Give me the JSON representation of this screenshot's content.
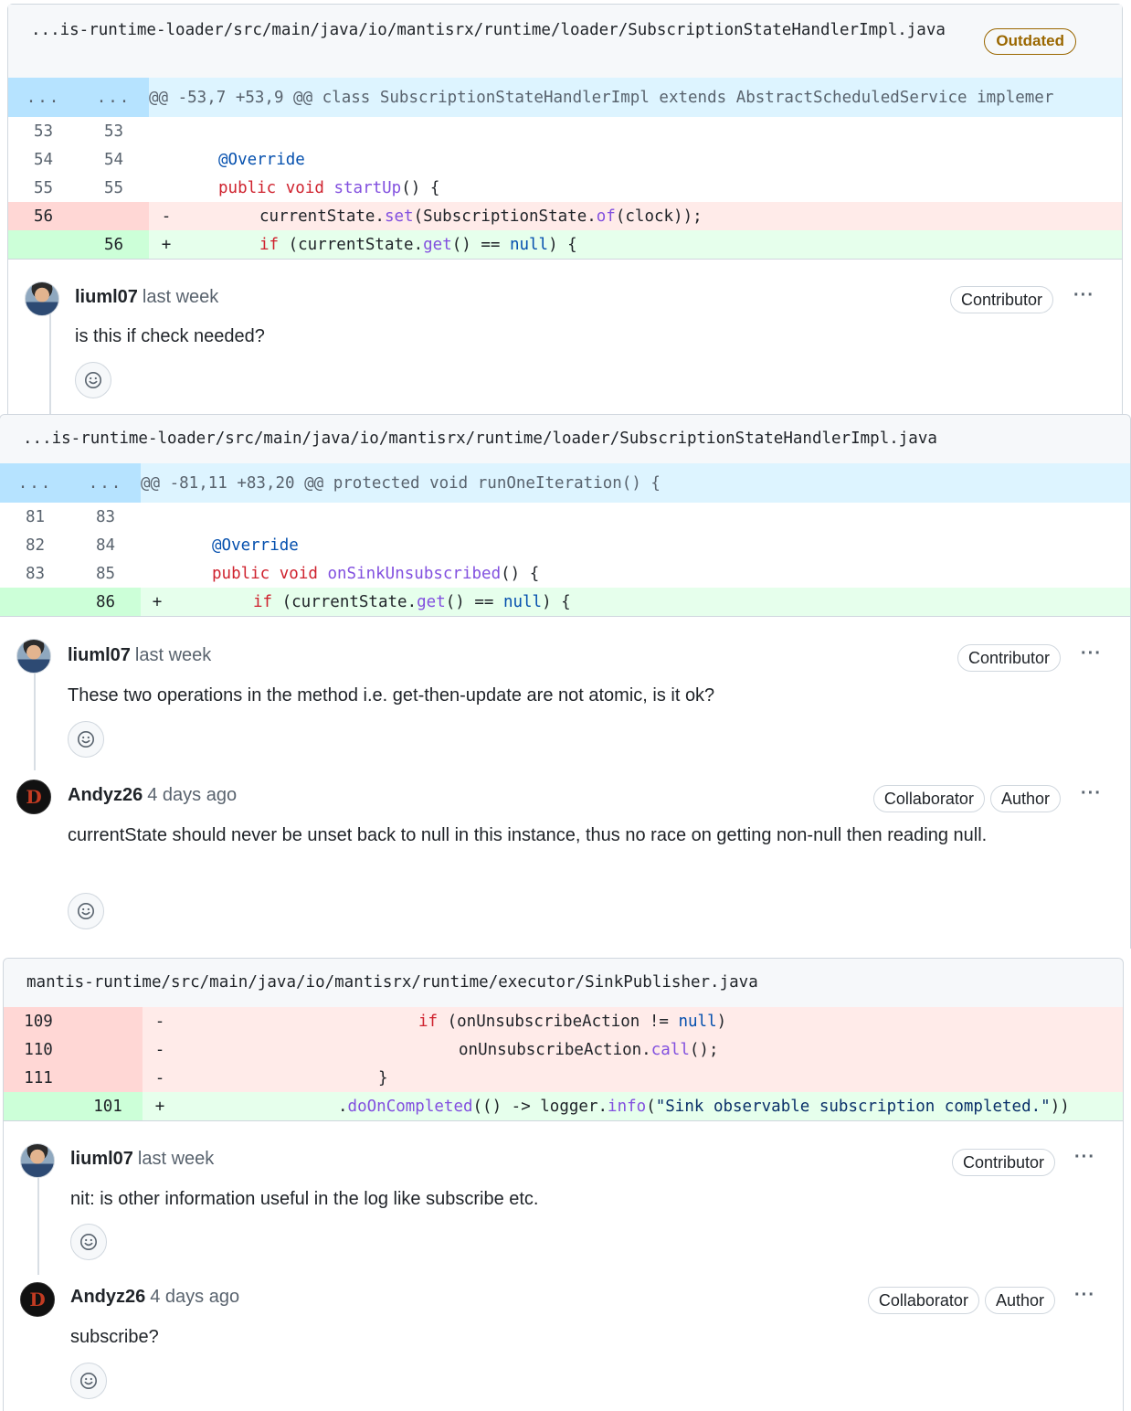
{
  "reviews": [
    {
      "file_path": "...is-runtime-loader/src/main/java/io/mantisrx/runtime/loader/SubscriptionStateHandlerImpl.java",
      "status_badge": "Outdated",
      "hunk_left": "...",
      "hunk_right": "...",
      "hunk_header": "@@ -53,7 +53,9 @@ class SubscriptionStateHandlerImpl extends AbstractScheduledService implemer",
      "lines": [
        {
          "old": "53",
          "new": "53",
          "sign": "",
          "code": ""
        },
        {
          "old": "54",
          "new": "54",
          "sign": "",
          "code": "@Override"
        },
        {
          "old": "55",
          "new": "55",
          "sign": "",
          "code": "public void startUp() {"
        },
        {
          "old": "56",
          "new": "",
          "sign": "-",
          "code": "currentState.set(SubscriptionState.of(clock));"
        },
        {
          "old": "",
          "new": "56",
          "sign": "+",
          "code": "if (currentState.get() == null) {"
        }
      ],
      "comments": [
        {
          "author": "liuml07",
          "time": "last week",
          "badges": [
            "Contributor"
          ],
          "text": "is this if check needed?"
        }
      ]
    },
    {
      "file_path": "...is-runtime-loader/src/main/java/io/mantisrx/runtime/loader/SubscriptionStateHandlerImpl.java",
      "hunk_left": "...",
      "hunk_right": "...",
      "hunk_header": "@@ -81,11 +83,20 @@ protected void runOneIteration() {",
      "lines": [
        {
          "old": "81",
          "new": "83",
          "sign": "",
          "code": ""
        },
        {
          "old": "82",
          "new": "84",
          "sign": "",
          "code": "@Override"
        },
        {
          "old": "83",
          "new": "85",
          "sign": "",
          "code": "public void onSinkUnsubscribed() {"
        },
        {
          "old": "",
          "new": "86",
          "sign": "+",
          "code": "if (currentState.get() == null) {"
        }
      ],
      "comments": [
        {
          "author": "liuml07",
          "time": "last week",
          "badges": [
            "Contributor"
          ],
          "text": "These two operations in the method i.e. get-then-update are not atomic, is it ok?"
        },
        {
          "author": "Andyz26",
          "time": "4 days ago",
          "badges": [
            "Collaborator",
            "Author"
          ],
          "text": "currentState should never be unset back to null in this instance, thus no race on getting non-null then reading null."
        }
      ]
    },
    {
      "file_path": "mantis-runtime/src/main/java/io/mantisrx/runtime/executor/SinkPublisher.java",
      "lines": [
        {
          "old": "109",
          "new": "",
          "sign": "-",
          "code": "if (onUnsubscribeAction != null)"
        },
        {
          "old": "110",
          "new": "",
          "sign": "-",
          "code": "onUnsubscribeAction.call();"
        },
        {
          "old": "111",
          "new": "",
          "sign": "-",
          "code": "}"
        },
        {
          "old": "",
          "new": "101",
          "sign": "+",
          "code": ".doOnCompleted(() -> logger.info(\"Sink observable subscription completed.\"))"
        }
      ],
      "comments": [
        {
          "author": "liuml07",
          "time": "last week",
          "badges": [
            "Contributor"
          ],
          "text": "nit: is other information useful in the log like subscribe etc."
        },
        {
          "author": "Andyz26",
          "time": "4 days ago",
          "badges": [
            "Collaborator",
            "Author"
          ],
          "text": "subscribe?"
        }
      ]
    }
  ],
  "ui": {
    "more_label": "···",
    "avatar_d_letter": "D"
  },
  "colors": {
    "deleted_bg": "#ffebe9",
    "added_bg": "#e6ffec",
    "hunk_bg": "#ddf4ff",
    "outdated": "#9a6700"
  }
}
